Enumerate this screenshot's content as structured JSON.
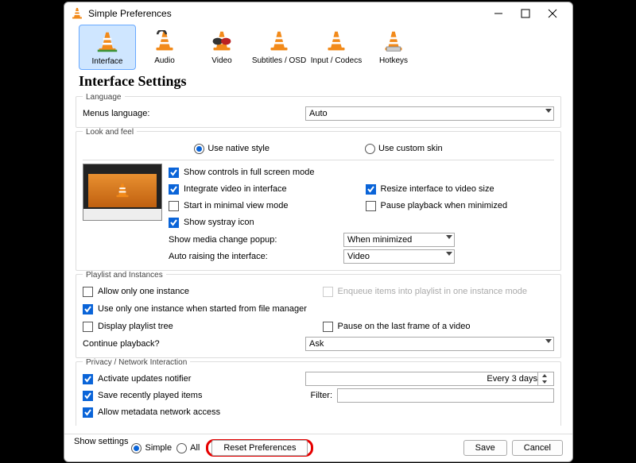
{
  "window": {
    "title": "Simple Preferences"
  },
  "tabs": {
    "interface": "Interface",
    "audio": "Audio",
    "video": "Video",
    "subtitles": "Subtitles / OSD",
    "input": "Input / Codecs",
    "hotkeys": "Hotkeys"
  },
  "heading": "Interface Settings",
  "language": {
    "group": "Language",
    "menus_label": "Menus language:",
    "value": "Auto"
  },
  "look": {
    "group": "Look and feel",
    "native": "Use native style",
    "custom": "Use custom skin",
    "fullscreen": "Show controls in full screen mode",
    "integrate": "Integrate video in interface",
    "resize": "Resize interface to video size",
    "minimal": "Start in minimal view mode",
    "pause_min": "Pause playback when minimized",
    "systray": "Show systray icon",
    "media_change": "Show media change popup:",
    "media_change_val": "When minimized",
    "auto_raise": "Auto raising the interface:",
    "auto_raise_val": "Video"
  },
  "playlist": {
    "group": "Playlist and Instances",
    "one_instance": "Allow only one instance",
    "enqueue": "Enqueue items into playlist in one instance mode",
    "one_file": "Use only one instance when started from file manager",
    "display_tree": "Display playlist tree",
    "pause_last": "Pause on the last frame of a video",
    "continue": "Continue playback?",
    "continue_val": "Ask"
  },
  "privacy": {
    "group": "Privacy / Network Interaction",
    "updates": "Activate updates notifier",
    "updates_val": "Every 3 days",
    "recent": "Save recently played items",
    "filter": "Filter:",
    "metadata": "Allow metadata network access"
  },
  "bottom": {
    "show_settings": "Show settings",
    "simple": "Simple",
    "all": "All",
    "reset": "Reset Preferences",
    "save": "Save",
    "cancel": "Cancel"
  }
}
